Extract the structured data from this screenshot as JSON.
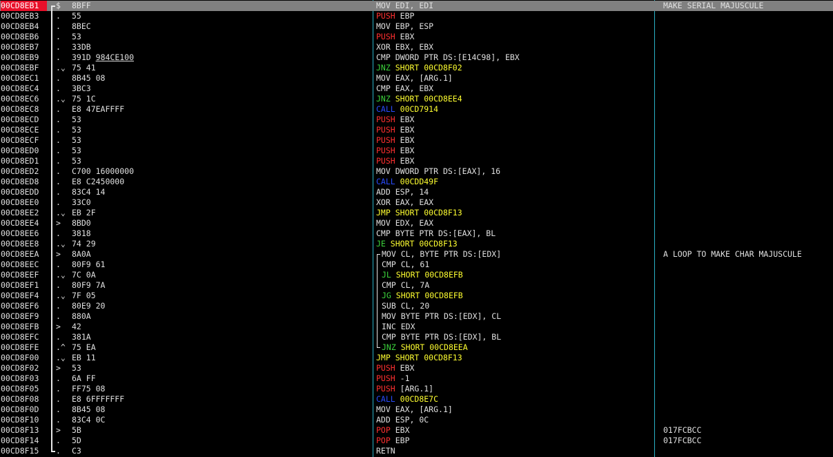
{
  "rows": [
    {
      "addr": "00CD8EB1",
      "mark": "$",
      "hex": "8BFF",
      "mn": "MOV",
      "cls": "norm",
      "ops": "EDI, EDI",
      "comment": "MAKE SERIAL MAJUSCULE"
    },
    {
      "addr": "00CD8EB3",
      "mark": ".",
      "hex": "55",
      "mn": "PUSH",
      "cls": "push",
      "ops": "EBP",
      "comment": ""
    },
    {
      "addr": "00CD8EB4",
      "mark": ".",
      "hex": "8BEC",
      "mn": "MOV",
      "cls": "norm",
      "ops": "EBP, ESP",
      "comment": ""
    },
    {
      "addr": "00CD8EB6",
      "mark": ".",
      "hex": "53",
      "mn": "PUSH",
      "cls": "push",
      "ops": "EBX",
      "comment": ""
    },
    {
      "addr": "00CD8EB7",
      "mark": ".",
      "hex": "33DB",
      "mn": "XOR",
      "cls": "norm",
      "ops": "EBX, EBX",
      "comment": ""
    },
    {
      "addr": "00CD8EB9",
      "mark": ".",
      "hex": "391D",
      "hex2": "984CE100",
      "mn": "CMP",
      "cls": "norm",
      "ops": "DWORD PTR DS:[E14C98], EBX",
      "comment": ""
    },
    {
      "addr": "00CD8EBF",
      "mark": ".⌄",
      "hex": "75 41",
      "mn": "JNZ",
      "cls": "jcc",
      "ops": "SHORT 00CD8F02",
      "comment": ""
    },
    {
      "addr": "00CD8EC1",
      "mark": ".",
      "hex": "8B45 08",
      "mn": "MOV",
      "cls": "norm",
      "ops": "EAX, [ARG.1]",
      "comment": ""
    },
    {
      "addr": "00CD8EC4",
      "mark": ".",
      "hex": "3BC3",
      "mn": "CMP",
      "cls": "norm",
      "ops": "EAX, EBX",
      "comment": ""
    },
    {
      "addr": "00CD8EC6",
      "mark": ".⌄",
      "hex": "75 1C",
      "mn": "JNZ",
      "cls": "jcc",
      "ops": "SHORT 00CD8EE4",
      "comment": ""
    },
    {
      "addr": "00CD8EC8",
      "mark": ".",
      "hex": "E8 47EAFFFF",
      "mn": "CALL",
      "cls": "call",
      "ops": "00CD7914",
      "comment": ""
    },
    {
      "addr": "00CD8ECD",
      "mark": ".",
      "hex": "53",
      "mn": "PUSH",
      "cls": "push",
      "ops": "EBX",
      "comment": ""
    },
    {
      "addr": "00CD8ECE",
      "mark": ".",
      "hex": "53",
      "mn": "PUSH",
      "cls": "push",
      "ops": "EBX",
      "comment": ""
    },
    {
      "addr": "00CD8ECF",
      "mark": ".",
      "hex": "53",
      "mn": "PUSH",
      "cls": "push",
      "ops": "EBX",
      "comment": ""
    },
    {
      "addr": "00CD8ED0",
      "mark": ".",
      "hex": "53",
      "mn": "PUSH",
      "cls": "push",
      "ops": "EBX",
      "comment": ""
    },
    {
      "addr": "00CD8ED1",
      "mark": ".",
      "hex": "53",
      "mn": "PUSH",
      "cls": "push",
      "ops": "EBX",
      "comment": ""
    },
    {
      "addr": "00CD8ED2",
      "mark": ".",
      "hex": "C700 16000000",
      "mn": "MOV",
      "cls": "norm",
      "ops": "DWORD PTR DS:[EAX], 16",
      "comment": ""
    },
    {
      "addr": "00CD8ED8",
      "mark": ".",
      "hex": "E8 C2450000",
      "mn": "CALL",
      "cls": "call",
      "ops": "00CDD49F",
      "comment": ""
    },
    {
      "addr": "00CD8EDD",
      "mark": ".",
      "hex": "83C4 14",
      "mn": "ADD",
      "cls": "norm",
      "ops": "ESP, 14",
      "comment": ""
    },
    {
      "addr": "00CD8EE0",
      "mark": ".",
      "hex": "33C0",
      "mn": "XOR",
      "cls": "norm",
      "ops": "EAX, EAX",
      "comment": ""
    },
    {
      "addr": "00CD8EE2",
      "mark": ".⌄",
      "hex": "EB 2F",
      "mn": "JMP",
      "cls": "jmp",
      "ops": "SHORT 00CD8F13",
      "comment": ""
    },
    {
      "addr": "00CD8EE4",
      "mark": ">",
      "hex": "8BD0",
      "mn": "MOV",
      "cls": "norm",
      "ops": "EDX, EAX",
      "comment": ""
    },
    {
      "addr": "00CD8EE6",
      "mark": ".",
      "hex": "3818",
      "mn": "CMP",
      "cls": "norm",
      "ops": "BYTE PTR DS:[EAX], BL",
      "comment": ""
    },
    {
      "addr": "00CD8EE8",
      "mark": ".⌄",
      "hex": "74 29",
      "mn": "JE",
      "cls": "jcc",
      "ops": "SHORT 00CD8F13",
      "comment": ""
    },
    {
      "addr": "00CD8EEA",
      "mark": ">",
      "hex": "8A0A",
      "mn": "MOV",
      "cls": "norm",
      "ops": "CL, BYTE PTR DS:[EDX]",
      "comment": "A LOOP TO MAKE CHAR MAJUSCULE",
      "loop": true
    },
    {
      "addr": "00CD8EEC",
      "mark": ".",
      "hex": "80F9 61",
      "mn": "CMP",
      "cls": "norm",
      "ops": "CL, 61",
      "comment": "",
      "loop": true
    },
    {
      "addr": "00CD8EEF",
      "mark": ".⌄",
      "hex": "7C 0A",
      "mn": "JL",
      "cls": "jcc",
      "ops": "SHORT 00CD8EFB",
      "comment": "",
      "loop": true
    },
    {
      "addr": "00CD8EF1",
      "mark": ".",
      "hex": "80F9 7A",
      "mn": "CMP",
      "cls": "norm",
      "ops": "CL, 7A",
      "comment": "",
      "loop": true
    },
    {
      "addr": "00CD8EF4",
      "mark": ".⌄",
      "hex": "7F 05",
      "mn": "JG",
      "cls": "jcc",
      "ops": "SHORT 00CD8EFB",
      "comment": "",
      "loop": true
    },
    {
      "addr": "00CD8EF6",
      "mark": ".",
      "hex": "80E9 20",
      "mn": "SUB",
      "cls": "norm",
      "ops": "CL, 20",
      "comment": "",
      "loop": true
    },
    {
      "addr": "00CD8EF9",
      "mark": ".",
      "hex": "880A",
      "mn": "MOV",
      "cls": "norm",
      "ops": "BYTE PTR DS:[EDX], CL",
      "comment": "",
      "loop": true
    },
    {
      "addr": "00CD8EFB",
      "mark": ">",
      "hex": "42",
      "mn": "INC",
      "cls": "norm",
      "ops": "EDX",
      "comment": "",
      "loop": true
    },
    {
      "addr": "00CD8EFC",
      "mark": ".",
      "hex": "381A",
      "mn": "CMP",
      "cls": "norm",
      "ops": "BYTE PTR DS:[EDX], BL",
      "comment": "",
      "loop": true
    },
    {
      "addr": "00CD8EFE",
      "mark": ".^",
      "hex": "75 EA",
      "mn": "JNZ",
      "cls": "jcc",
      "ops": "SHORT 00CD8EEA",
      "comment": "",
      "loop": true
    },
    {
      "addr": "00CD8F00",
      "mark": ".⌄",
      "hex": "EB 11",
      "mn": "JMP",
      "cls": "jmp",
      "ops": "SHORT 00CD8F13",
      "comment": ""
    },
    {
      "addr": "00CD8F02",
      "mark": ">",
      "hex": "53",
      "mn": "PUSH",
      "cls": "push",
      "ops": "EBX",
      "comment": ""
    },
    {
      "addr": "00CD8F03",
      "mark": ".",
      "hex": "6A FF",
      "mn": "PUSH",
      "cls": "push",
      "ops": "-1",
      "comment": ""
    },
    {
      "addr": "00CD8F05",
      "mark": ".",
      "hex": "FF75 08",
      "mn": "PUSH",
      "cls": "push",
      "ops": "[ARG.1]",
      "comment": ""
    },
    {
      "addr": "00CD8F08",
      "mark": ".",
      "hex": "E8 6FFFFFFF",
      "mn": "CALL",
      "cls": "call",
      "ops": "00CD8E7C",
      "comment": ""
    },
    {
      "addr": "00CD8F0D",
      "mark": ".",
      "hex": "8B45 08",
      "mn": "MOV",
      "cls": "norm",
      "ops": "EAX, [ARG.1]",
      "comment": ""
    },
    {
      "addr": "00CD8F10",
      "mark": ".",
      "hex": "83C4 0C",
      "mn": "ADD",
      "cls": "norm",
      "ops": "ESP, 0C",
      "comment": ""
    },
    {
      "addr": "00CD8F13",
      "mark": ">",
      "hex": "5B",
      "mn": "POP",
      "cls": "pop",
      "ops": "EBX",
      "comment": "017FCBCC"
    },
    {
      "addr": "00CD8F14",
      "mark": ".",
      "hex": "5D",
      "mn": "POP",
      "cls": "pop",
      "ops": "EBP",
      "comment": "017FCBCC"
    },
    {
      "addr": "00CD8F15",
      "mark": ".",
      "hex": "C3",
      "mn": "RETN",
      "cls": "norm",
      "ops": "",
      "comment": ""
    }
  ],
  "selected_row": 0,
  "colors": {
    "background": "#000000",
    "text": "#e0e0e0",
    "selected_address_bg": "#e8102a",
    "selected_row_bg": "#808080",
    "column_divider": "#2ab3c8",
    "push_pop": "#ff3030",
    "conditional_jump": "#3cd43c",
    "jump_target": "#ffff30",
    "call": "#2a4cff"
  }
}
